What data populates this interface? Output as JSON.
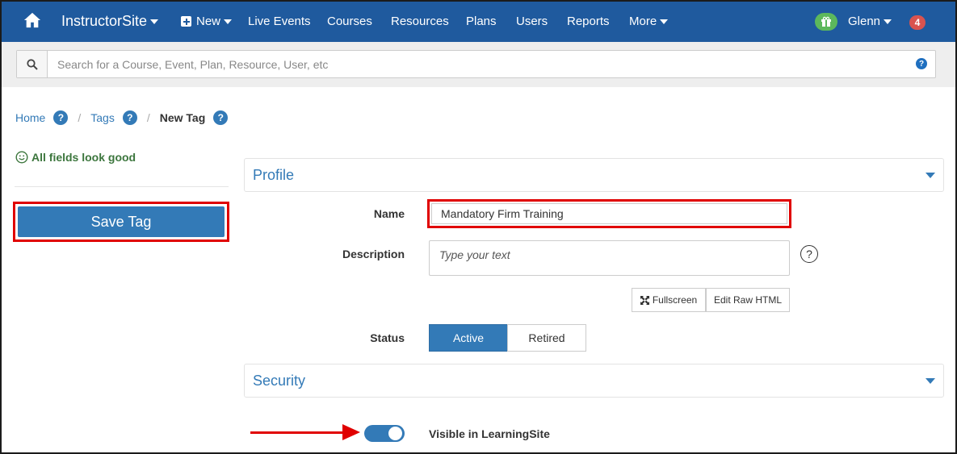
{
  "nav": {
    "brand": "InstructorSite",
    "new_label": "New",
    "items": [
      "Live Events",
      "Courses",
      "Resources",
      "Plans",
      "Users",
      "Reports"
    ],
    "more_label": "More",
    "user_name": "Glenn",
    "notification_count": "4",
    "colors": {
      "bar": "#1f5a9e",
      "gift": "#5cb85c",
      "badge": "#d9534f"
    }
  },
  "search": {
    "placeholder": "Search for a Course, Event, Plan, Resource, User, etc",
    "help": "?"
  },
  "breadcrumb": {
    "home": "Home",
    "tags": "Tags",
    "current": "New Tag",
    "help": "?"
  },
  "status": {
    "message": "All fields look good"
  },
  "actions": {
    "save_label": "Save Tag"
  },
  "profile": {
    "title": "Profile",
    "name_label": "Name",
    "name_value": "Mandatory Firm Training",
    "description_label": "Description",
    "description_placeholder": "Type your text",
    "description_help": "?",
    "fullscreen_label": "Fullscreen",
    "edit_raw_label": "Edit Raw HTML",
    "status_label": "Status",
    "status_active": "Active",
    "status_retired": "Retired",
    "status_selected": "Active"
  },
  "security": {
    "title": "Security",
    "visible_label": "Visible in LearningSite",
    "visible_on": true
  }
}
